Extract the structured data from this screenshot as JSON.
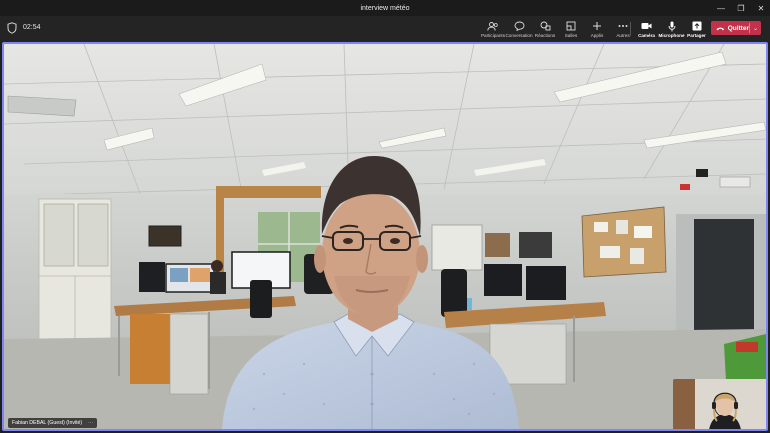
{
  "window": {
    "title": "interview météo"
  },
  "meeting": {
    "elapsed": "02:54"
  },
  "toolbar": {
    "items": [
      {
        "label": "Participants",
        "icon": "participants-icon"
      },
      {
        "label": "Conversation",
        "icon": "chat-icon"
      },
      {
        "label": "Réactions",
        "icon": "reactions-icon"
      },
      {
        "label": "Salles",
        "icon": "rooms-icon"
      },
      {
        "label": "Applis",
        "icon": "apps-icon"
      },
      {
        "label": "Autres",
        "icon": "more-icon"
      }
    ],
    "devices": [
      {
        "label": "Caméra",
        "icon": "camera-icon"
      },
      {
        "label": "Microphone",
        "icon": "microphone-icon"
      },
      {
        "label": "Partager",
        "icon": "share-icon"
      }
    ],
    "leave_label": "Quitter",
    "leave_color": "#c4314b"
  },
  "stage": {
    "speaker_name": "Fabian DEBAL (Guest) (Invité)",
    "active_border_color": "#7f85f5"
  }
}
